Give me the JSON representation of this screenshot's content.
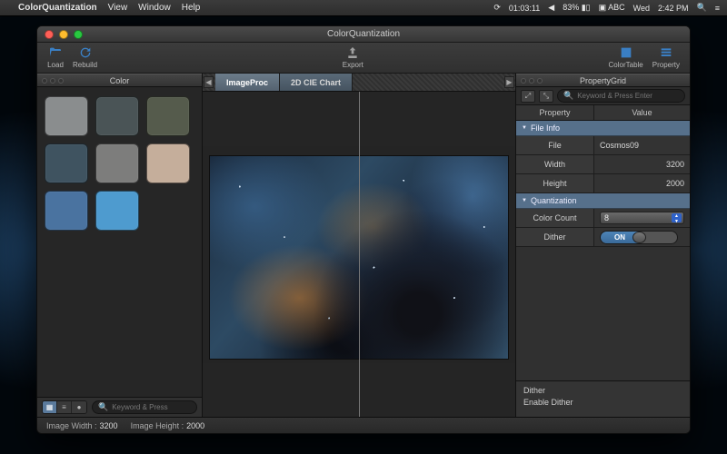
{
  "menubar": {
    "app": "ColorQuantization",
    "items": [
      "View",
      "Window",
      "Help"
    ],
    "status": {
      "timer": "01:03:11",
      "battery": "83%",
      "input": "ABC",
      "day": "Wed",
      "time": "2:42 PM"
    }
  },
  "window": {
    "title": "ColorQuantization",
    "toolbar": {
      "load": "Load",
      "rebuild": "Rebuild",
      "export": "Export",
      "colortable": "ColorTable",
      "property": "Property"
    }
  },
  "color_panel": {
    "title": "Color",
    "swatches": [
      "#8a8d8e",
      "#4a5456",
      "#555b4c",
      "#3f5360",
      "#7d7d7c",
      "#c5ae9b",
      "#4a73a0",
      "#4e9bcf"
    ],
    "search_placeholder": "Keyword & Press"
  },
  "center": {
    "tab_image": "ImageProc",
    "tab_cie": "2D CIE Chart"
  },
  "property_panel": {
    "title": "PropertyGrid",
    "search_placeholder": "Keyword & Press Enter",
    "col_property": "Property",
    "col_value": "Value",
    "sec_fileinfo": "File Info",
    "file_k": "File",
    "file_v": "Cosmos09",
    "width_k": "Width",
    "width_v": "3200",
    "height_k": "Height",
    "height_v": "2000",
    "sec_quant": "Quantization",
    "colorcount_k": "Color Count",
    "colorcount_v": "8",
    "dither_k": "Dither",
    "dither_on": "ON",
    "help_title": "Dither",
    "help_body": "Enable Dither"
  },
  "footer": {
    "imgw_label": "Image Width :",
    "imgw_val": "3200",
    "imgh_label": "Image Height :",
    "imgh_val": "2000"
  }
}
